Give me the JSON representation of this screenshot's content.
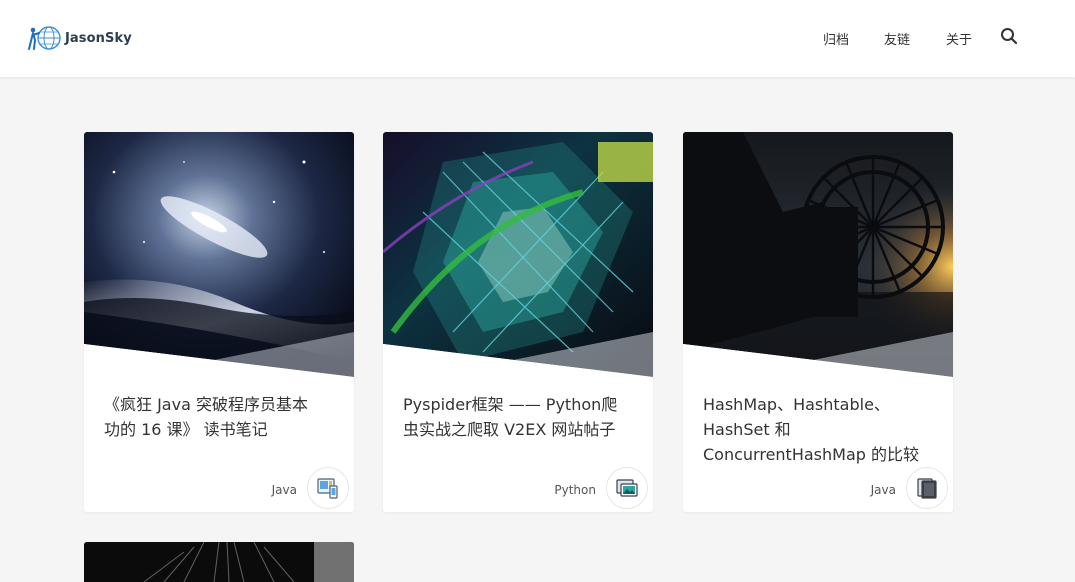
{
  "site": {
    "logo_text": "JasonSky"
  },
  "nav": {
    "items": [
      "归档",
      "友链",
      "关于"
    ],
    "search_icon": "search-icon"
  },
  "posts": [
    {
      "title_line1": "《疯狂 Java 突破程序员基本",
      "title_line2": "功的 16 课》 读书笔记",
      "title_line3": "",
      "category": "Java",
      "icon": "tablet-phone-icon",
      "image": "galaxy-nebula"
    },
    {
      "title_line1": "Pyspider框架 —— Python爬",
      "title_line2": "虫实战之爬取 V2EX 网站帖子",
      "title_line3": "",
      "category": "Python",
      "icon": "monitor-window-icon",
      "image": "neon-3d-grid"
    },
    {
      "title_line1": "HashMap、Hashtable、",
      "title_line2": "HashSet 和",
      "title_line3": "ConcurrentHashMap 的比较",
      "category": "Java",
      "icon": "document-stack-icon",
      "image": "waterwheel-sunset"
    }
  ]
}
